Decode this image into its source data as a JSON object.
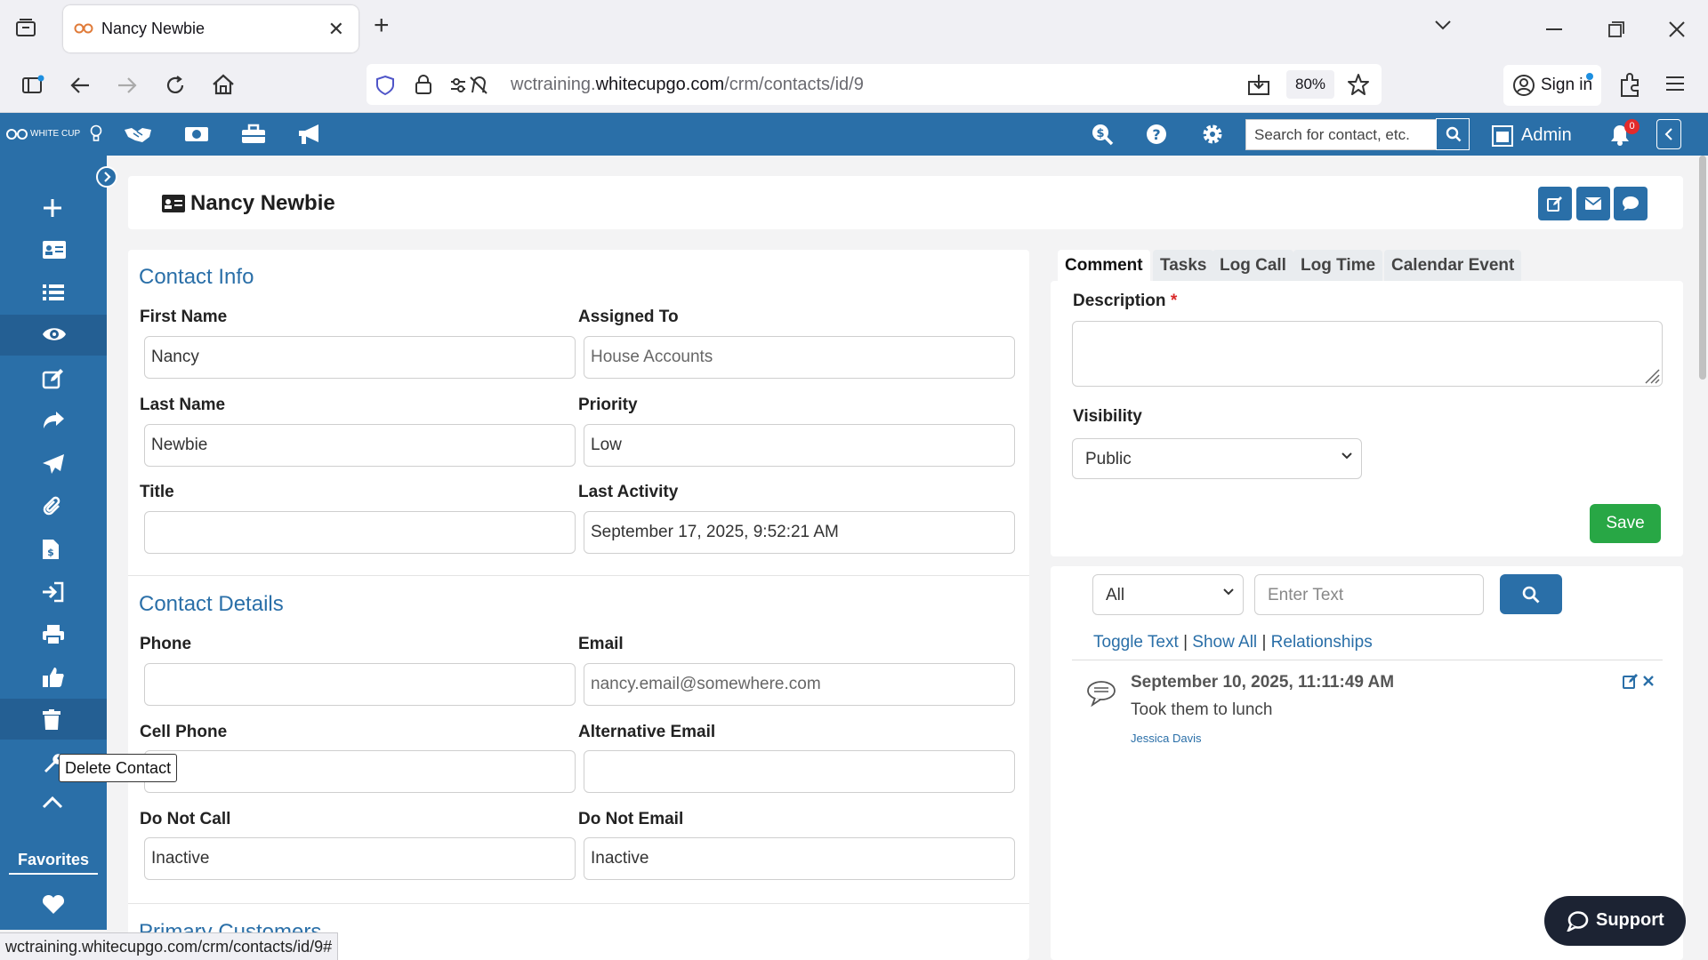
{
  "browser": {
    "tab_title": "Nancy Newbie",
    "url_host_prefix": "wctraining.",
    "url_host_domain": "whitecupgo.com",
    "url_path": "/crm/contacts/id/9",
    "zoom": "80%",
    "sign_in": "Sign in",
    "status_url": "wctraining.whitecupgo.com/crm/contacts/id/9#"
  },
  "header": {
    "logo_text": "WHITE CUP",
    "search_placeholder": "Search for contact, etc.",
    "admin_label": "Admin",
    "notification_count": "0"
  },
  "sidebar": {
    "favorites_label": "Favorites",
    "tooltip": "Delete Contact"
  },
  "contact": {
    "name": "Nancy Newbie"
  },
  "contact_info": {
    "section_title": "Contact Info",
    "first_name_label": "First Name",
    "first_name": "Nancy",
    "assigned_to_label": "Assigned To",
    "assigned_to": "House Accounts",
    "last_name_label": "Last Name",
    "last_name": "Newbie",
    "priority_label": "Priority",
    "priority": "Low",
    "title_label": "Title",
    "title": "",
    "last_activity_label": "Last Activity",
    "last_activity": "September 17, 2025, 9:52:21 AM"
  },
  "contact_details": {
    "section_title": "Contact Details",
    "phone_label": "Phone",
    "phone": "",
    "email_label": "Email",
    "email": "nancy.email@somewhere.com",
    "cell_phone_label": "Cell Phone",
    "cell_phone": "",
    "alt_email_label": "Alternative Email",
    "alt_email": "",
    "do_not_call_label": "Do Not Call",
    "do_not_call": "Inactive",
    "do_not_email_label": "Do Not Email",
    "do_not_email": "Inactive"
  },
  "primary_customers": {
    "section_title": "Primary Customers"
  },
  "activity": {
    "tabs": [
      "Comment",
      "Tasks",
      "Log Call",
      "Log Time",
      "Calendar Event"
    ],
    "description_label": "Description",
    "required_mark": "*",
    "visibility_label": "Visibility",
    "visibility_value": "Public",
    "save_label": "Save"
  },
  "feed": {
    "filter_value": "All",
    "text_placeholder": "Enter Text",
    "toggle_text": "Toggle Text",
    "show_all": "Show All",
    "relationships": "Relationships",
    "separator": "|",
    "comments": [
      {
        "date": "September 10, 2025, 11:11:49 AM",
        "text": "Took them to lunch",
        "author": "Jessica Davis"
      }
    ]
  },
  "support": {
    "label": "Support"
  },
  "colors": {
    "brand": "#2a6fa8",
    "save": "#28a745",
    "badge": "#e32b2b",
    "support_bg": "#1c2333"
  }
}
